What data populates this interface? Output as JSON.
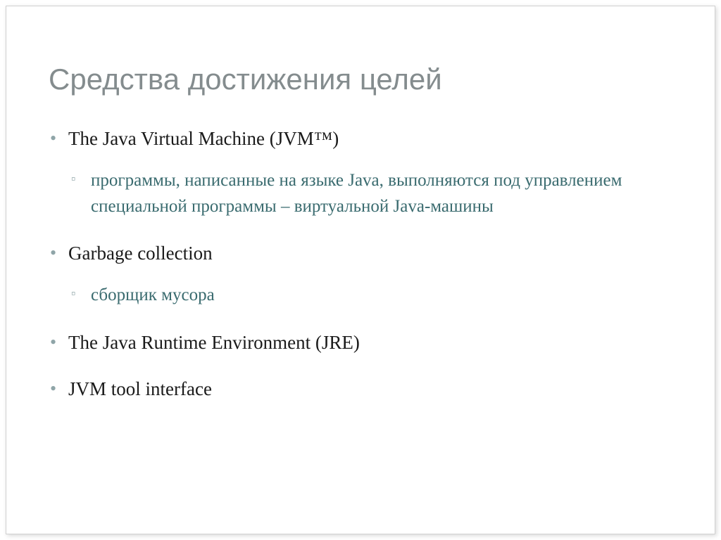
{
  "slide": {
    "title": "Средства достижения целей",
    "bullets": [
      {
        "text": "The Java Virtual Machine (JVM™)",
        "sub": [
          "программы, написанные на языке Java, выполняются под управлением специальной программы – виртуальной Java-машины"
        ]
      },
      {
        "text": "Garbage collection",
        "sub": [
          "сборщик мусора"
        ]
      },
      {
        "text": "The Java Runtime Environment (JRE)",
        "sub": []
      },
      {
        "text": "JVM tool interface",
        "sub": []
      }
    ]
  }
}
